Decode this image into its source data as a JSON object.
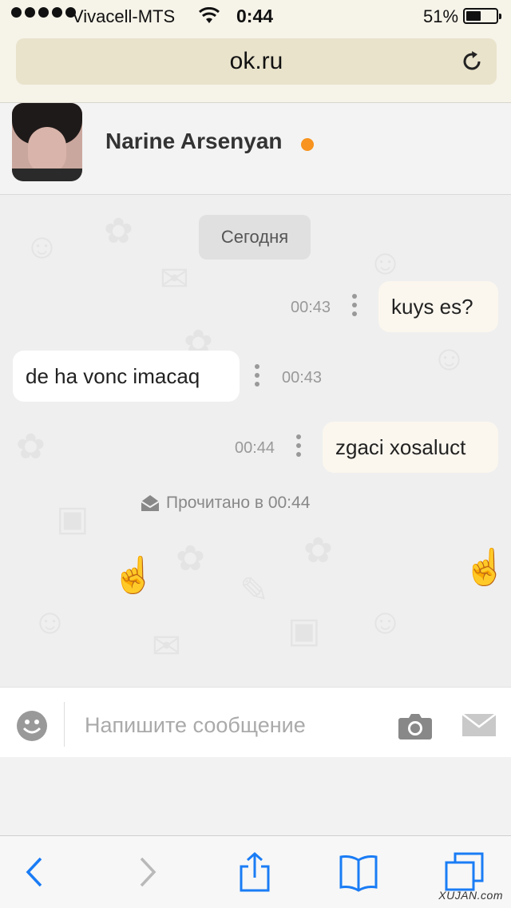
{
  "status_bar": {
    "carrier": "Vivacell-MTS",
    "time": "0:44",
    "battery_percent": "51%",
    "battery_level": 0.51,
    "signal_dots": 5
  },
  "browser": {
    "url": "ok.ru",
    "reload_icon": "reload-icon"
  },
  "chat_header": {
    "contact_name": "Narine Arsenyan",
    "online_indicator_color": "#f7931e",
    "avatar": "avatar"
  },
  "conversation": {
    "date_separator": "Сегодня",
    "messages": [
      {
        "direction": "outgoing",
        "text": "kuys es?",
        "time": "00:43"
      },
      {
        "direction": "incoming",
        "text": "de ha vonc imacaq",
        "time": "00:43"
      },
      {
        "direction": "outgoing",
        "text": "zgaci xosaluct",
        "time": "00:44"
      }
    ],
    "read_status": "Прочитано в 00:44"
  },
  "composer": {
    "placeholder": "Напишите сообщение",
    "emoji_icon": "smile-icon",
    "camera_icon": "camera-icon",
    "send_icon": "envelope-icon"
  },
  "safari_toolbar": {
    "items": [
      "back-icon",
      "forward-icon",
      "share-icon",
      "bookmarks-icon",
      "tabs-icon"
    ]
  },
  "watermark": "XUJAN.com"
}
